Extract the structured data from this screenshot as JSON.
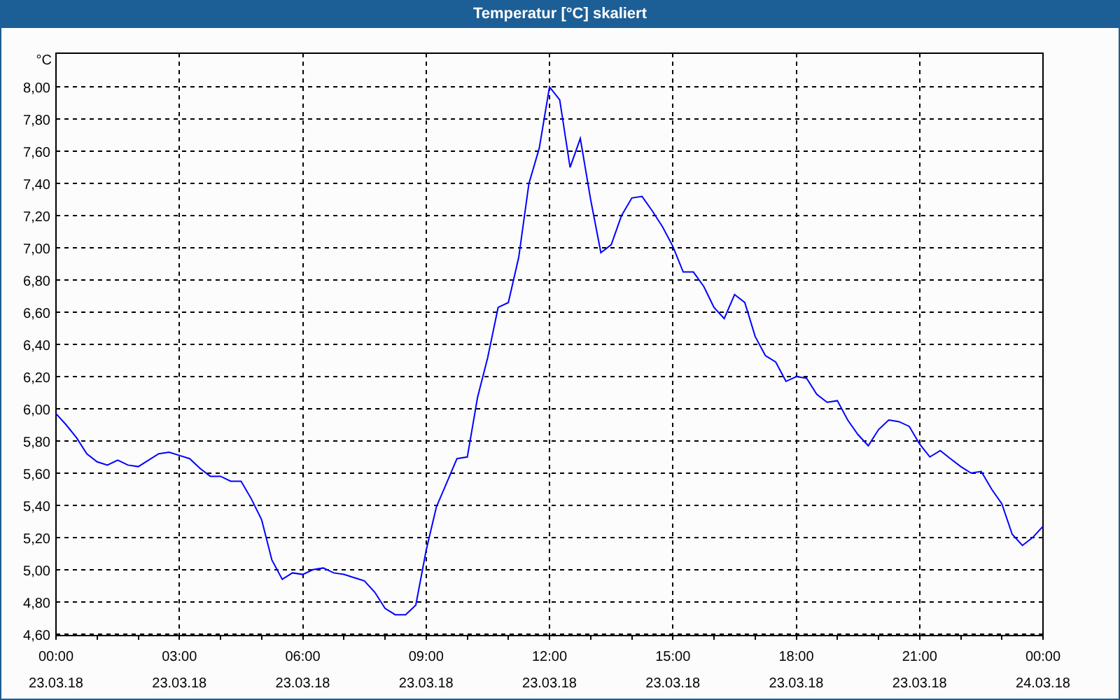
{
  "chart": {
    "chart_data": {
      "type": "line",
      "title": "Temperatur [°C] skaliert",
      "ylabel": "°C",
      "grid": true,
      "ylim": [
        4.59,
        8.21
      ],
      "yticks": [
        {
          "value": 4.6,
          "label": "4,60"
        },
        {
          "value": 4.8,
          "label": "4,80"
        },
        {
          "value": 5.0,
          "label": "5,00"
        },
        {
          "value": 5.2,
          "label": "5,20"
        },
        {
          "value": 5.4,
          "label": "5,40"
        },
        {
          "value": 5.6,
          "label": "5,60"
        },
        {
          "value": 5.8,
          "label": "5,80"
        },
        {
          "value": 6.0,
          "label": "6,00"
        },
        {
          "value": 6.2,
          "label": "6,20"
        },
        {
          "value": 6.4,
          "label": "6,40"
        },
        {
          "value": 6.6,
          "label": "6,60"
        },
        {
          "value": 6.8,
          "label": "6,80"
        },
        {
          "value": 7.0,
          "label": "7,00"
        },
        {
          "value": 7.2,
          "label": "7,20"
        },
        {
          "value": 7.4,
          "label": "7,40"
        },
        {
          "value": 7.6,
          "label": "7,60"
        },
        {
          "value": 7.8,
          "label": "7,80"
        },
        {
          "value": 8.0,
          "label": "8,00"
        }
      ],
      "categories": [
        "00:00\n23.03.18",
        null,
        null,
        null,
        null,
        null,
        null,
        null,
        null,
        null,
        null,
        null,
        "03:00\n23.03.18",
        null,
        null,
        null,
        null,
        null,
        null,
        null,
        null,
        null,
        null,
        null,
        "06:00\n23.03.18",
        null,
        null,
        null,
        null,
        null,
        null,
        null,
        null,
        null,
        null,
        null,
        "09:00\n23.03.18",
        null,
        null,
        null,
        null,
        null,
        null,
        null,
        null,
        null,
        null,
        null,
        "12:00\n23.03.18",
        null,
        null,
        null,
        null,
        null,
        null,
        null,
        null,
        null,
        null,
        null,
        "15:00\n23.03.18",
        null,
        null,
        null,
        null,
        null,
        null,
        null,
        null,
        null,
        null,
        null,
        "18:00\n23.03.18",
        null,
        null,
        null,
        null,
        null,
        null,
        null,
        null,
        null,
        null,
        null,
        "21:00\n23.03.18",
        null,
        null,
        null,
        null,
        null,
        null,
        null,
        null,
        null,
        null,
        null,
        "00:00\n24.03.18"
      ],
      "series": [
        {
          "color": "#0000ff",
          "values": [
            5.97,
            5.9,
            5.82,
            5.72,
            5.67,
            5.65,
            5.68,
            5.65,
            5.64,
            5.68,
            5.72,
            5.73,
            5.71,
            5.69,
            5.63,
            5.58,
            5.58,
            5.55,
            5.55,
            5.44,
            5.31,
            5.06,
            4.94,
            4.98,
            4.97,
            5.0,
            5.01,
            4.98,
            4.97,
            4.95,
            4.93,
            4.86,
            4.76,
            4.72,
            4.72,
            4.78,
            5.12,
            5.39,
            5.54,
            5.69,
            5.7,
            6.07,
            6.32,
            6.63,
            6.66,
            6.94,
            7.4,
            7.62,
            8.0,
            7.92,
            7.5,
            7.68,
            7.3,
            6.97,
            7.02,
            7.2,
            7.31,
            7.32,
            7.23,
            7.13,
            7.01,
            6.85,
            6.85,
            6.76,
            6.63,
            6.56,
            6.71,
            6.66,
            6.45,
            6.33,
            6.29,
            6.17,
            6.2,
            6.19,
            6.09,
            6.04,
            6.05,
            5.93,
            5.84,
            5.77,
            5.87,
            5.93,
            5.92,
            5.89,
            5.78,
            5.7,
            5.74,
            5.69,
            5.64,
            5.6,
            5.61,
            5.5,
            5.41,
            5.22,
            5.15,
            5.2,
            5.27
          ]
        }
      ]
    }
  }
}
